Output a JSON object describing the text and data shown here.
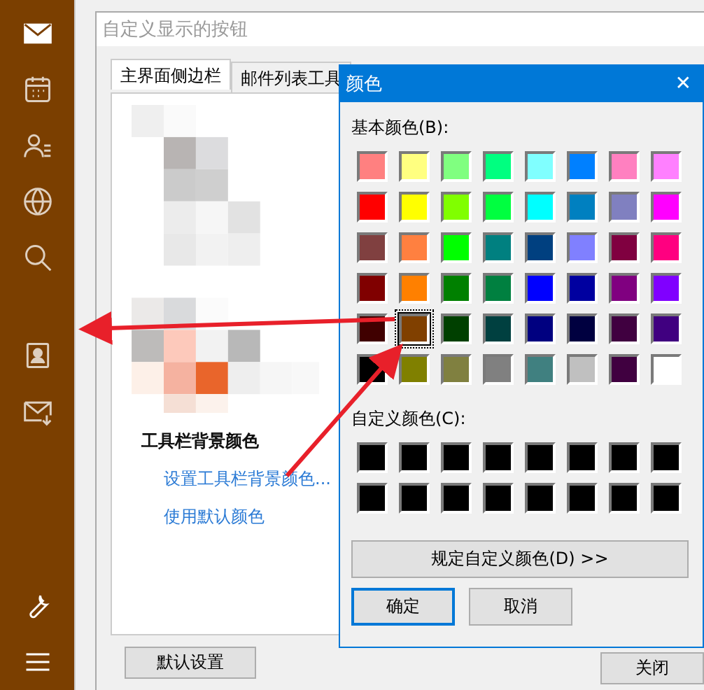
{
  "sidebar": {
    "items": [
      {
        "kind": "mail",
        "selected": true
      },
      {
        "kind": "calendar",
        "selected": false
      },
      {
        "kind": "contacts",
        "selected": false
      },
      {
        "kind": "globe",
        "selected": false
      },
      {
        "kind": "search",
        "selected": false
      },
      {
        "kind": "card",
        "selected": false
      },
      {
        "kind": "mail-flag",
        "selected": false
      }
    ],
    "bottom_items": [
      {
        "kind": "wrench"
      },
      {
        "kind": "menu"
      }
    ]
  },
  "customize_dialog": {
    "title": "自定义显示的按钮",
    "tabs": [
      {
        "label": "主界面侧边栏",
        "selected": true
      },
      {
        "label": "邮件列表工具",
        "selected": false
      }
    ],
    "section_title": "工具栏背景颜色",
    "links": [
      "设置工具栏背景颜色...",
      "使用默认颜色"
    ],
    "buttons": [
      "默认设置",
      "关闭"
    ]
  },
  "color_dialog": {
    "title": "颜色",
    "close": "✕",
    "basic_label": "基本颜色(B):",
    "basic_colors": [
      {
        "color": "#ff8080",
        "selected": false
      },
      {
        "color": "#ffff80",
        "selected": false
      },
      {
        "color": "#80ff80",
        "selected": false
      },
      {
        "color": "#00ff80",
        "selected": false
      },
      {
        "color": "#80ffff",
        "selected": false
      },
      {
        "color": "#0080ff",
        "selected": false
      },
      {
        "color": "#ff80c0",
        "selected": false
      },
      {
        "color": "#ff80ff",
        "selected": false
      },
      {
        "color": "#ff0000",
        "selected": false
      },
      {
        "color": "#ffff00",
        "selected": false
      },
      {
        "color": "#80ff00",
        "selected": false
      },
      {
        "color": "#00ff40",
        "selected": false
      },
      {
        "color": "#00ffff",
        "selected": false
      },
      {
        "color": "#0080c0",
        "selected": false
      },
      {
        "color": "#8080c0",
        "selected": false
      },
      {
        "color": "#ff00ff",
        "selected": false
      },
      {
        "color": "#804040",
        "selected": false
      },
      {
        "color": "#ff8040",
        "selected": false
      },
      {
        "color": "#00ff00",
        "selected": false
      },
      {
        "color": "#008080",
        "selected": false
      },
      {
        "color": "#004080",
        "selected": false
      },
      {
        "color": "#8080ff",
        "selected": false
      },
      {
        "color": "#800040",
        "selected": false
      },
      {
        "color": "#ff0080",
        "selected": false
      },
      {
        "color": "#800000",
        "selected": false
      },
      {
        "color": "#ff8000",
        "selected": false
      },
      {
        "color": "#008000",
        "selected": false
      },
      {
        "color": "#008040",
        "selected": false
      },
      {
        "color": "#0000ff",
        "selected": false
      },
      {
        "color": "#0000a0",
        "selected": false
      },
      {
        "color": "#800080",
        "selected": false
      },
      {
        "color": "#8000ff",
        "selected": false
      },
      {
        "color": "#400000",
        "selected": false
      },
      {
        "color": "#804000",
        "selected": true
      },
      {
        "color": "#004000",
        "selected": false
      },
      {
        "color": "#004040",
        "selected": false
      },
      {
        "color": "#000080",
        "selected": false
      },
      {
        "color": "#000040",
        "selected": false
      },
      {
        "color": "#400040",
        "selected": false
      },
      {
        "color": "#400080",
        "selected": false
      },
      {
        "color": "#000000",
        "selected": false
      },
      {
        "color": "#808000",
        "selected": false
      },
      {
        "color": "#808040",
        "selected": false
      },
      {
        "color": "#808080",
        "selected": false
      },
      {
        "color": "#408080",
        "selected": false
      },
      {
        "color": "#c0c0c0",
        "selected": false
      },
      {
        "color": "#400040",
        "selected": false
      },
      {
        "color": "#ffffff",
        "selected": false
      }
    ],
    "custom_label": "自定义颜色(C):",
    "custom_colors": [
      {
        "color": "#000000"
      },
      {
        "color": "#000000"
      },
      {
        "color": "#000000"
      },
      {
        "color": "#000000"
      },
      {
        "color": "#000000"
      },
      {
        "color": "#000000"
      },
      {
        "color": "#000000"
      },
      {
        "color": "#000000"
      },
      {
        "color": "#000000"
      },
      {
        "color": "#000000"
      },
      {
        "color": "#000000"
      },
      {
        "color": "#000000"
      },
      {
        "color": "#000000"
      },
      {
        "color": "#000000"
      },
      {
        "color": "#000000"
      },
      {
        "color": "#000000"
      }
    ],
    "define_button": "规定自定义颜色(D) >>",
    "ok_button": "确定",
    "cancel_button": "取消"
  }
}
